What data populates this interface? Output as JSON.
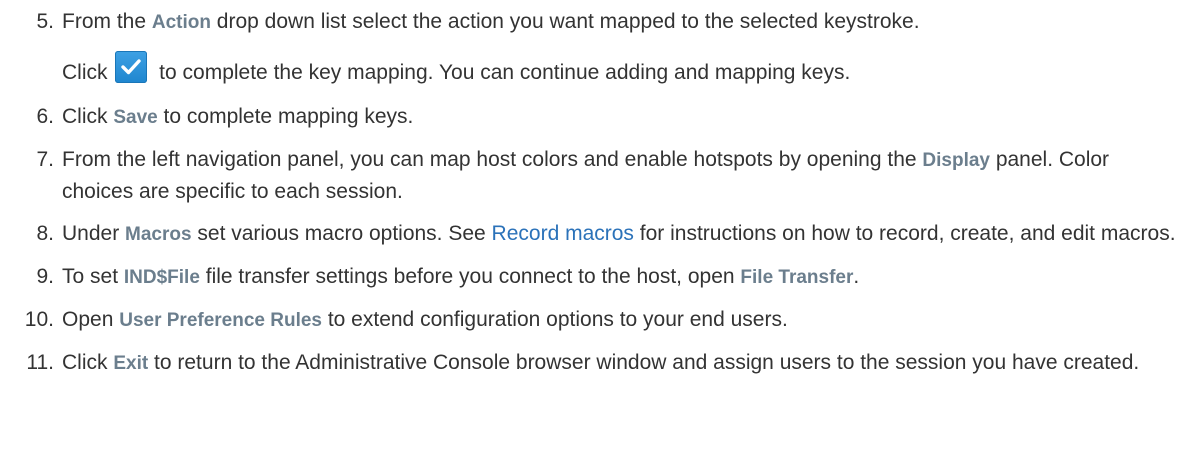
{
  "steps": [
    {
      "num": "5.",
      "pre": "From the ",
      "ui": "Action",
      "post": " drop down list select the action you want mapped to the selected keystroke.",
      "sub_pre": "Click ",
      "sub_icon": "checkmark-icon",
      "sub_post": " to complete the key mapping. You can continue adding and mapping keys."
    },
    {
      "num": "6.",
      "pre": "Click ",
      "ui": "Save",
      "post": " to complete mapping keys."
    },
    {
      "num": "7.",
      "pre": "From the left navigation panel, you can map host colors and enable hotspots by opening the ",
      "ui": "Display",
      "post": " panel. Color choices are specific to each session."
    },
    {
      "num": "8.",
      "pre": "Under ",
      "ui": "Macros",
      "mid": " set various macro options. See ",
      "link": "Record macros",
      "post": " for instructions on how to record, create, and edit macros."
    },
    {
      "num": "9.",
      "pre": "To set ",
      "ui": "IND$File",
      "mid": " file transfer settings before you connect to the host, open ",
      "ui2": "File Transfer",
      "post": "."
    },
    {
      "num": "10.",
      "pre": "Open ",
      "ui": "User Preference Rules",
      "post": " to extend configuration options to your end users."
    },
    {
      "num": "11.",
      "pre": "Click ",
      "ui": "Exit",
      "post": " to return to the Administrative Console browser window and assign users to the session you have created."
    }
  ],
  "colors": {
    "text": "#333333",
    "ui_label": "#6b7e8d",
    "link": "#2b72b9",
    "icon_bg": "#2a93db"
  }
}
